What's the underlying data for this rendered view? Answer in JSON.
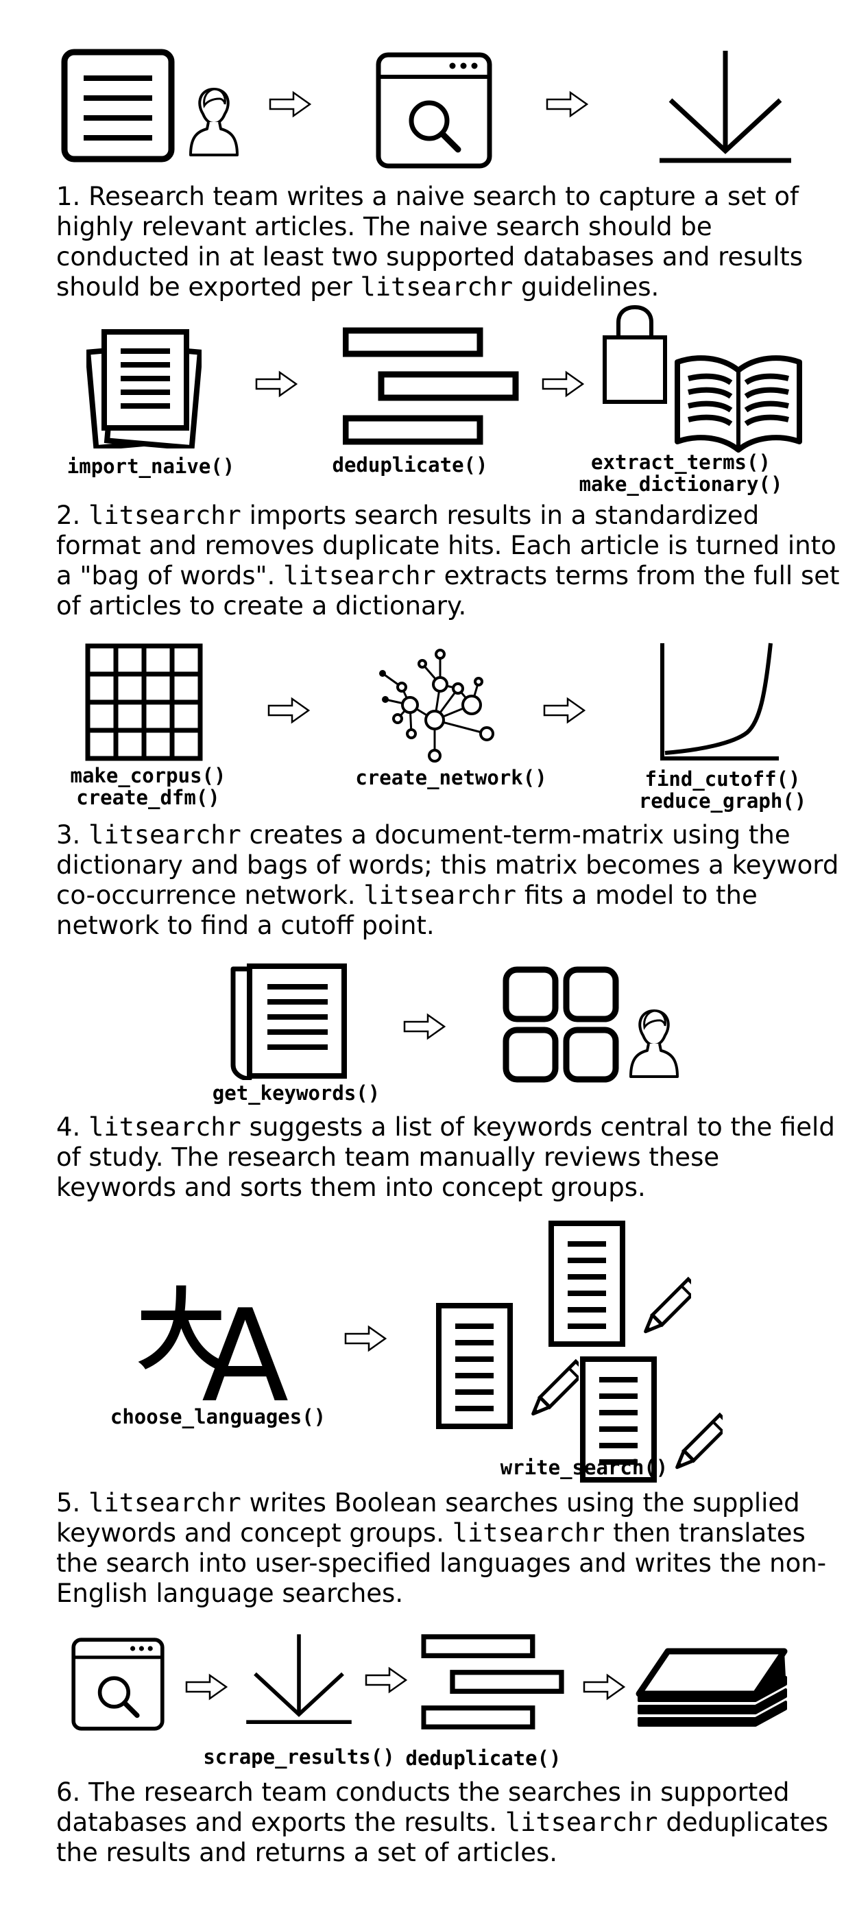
{
  "steps": [
    {
      "number": "1.",
      "description": [
        {
          "t": " Research team writes a naive search to capture a set of highly relevant articles. The naive search should be conducted in at least two supported databases and results should be exported per "
        },
        {
          "t": "litsearchr",
          "code": true
        },
        {
          "t": " guidelines."
        }
      ],
      "icons": [
        "document-icon",
        "person-icon",
        "browser-search-icon",
        "download-icon"
      ]
    },
    {
      "number": "2.",
      "labels": [
        "import_naive()",
        "deduplicate()",
        "extract_terms()",
        "make_dictionary()"
      ],
      "description": [
        {
          "t": " "
        },
        {
          "t": "litsearchr",
          "code": true
        },
        {
          "t": " imports search results in a standardized format and removes duplicate hits. Each article is turned into a \"bag of words\". "
        },
        {
          "t": "litsearchr",
          "code": true
        },
        {
          "t": " extracts terms from the full set of articles to create a dictionary."
        }
      ],
      "icons": [
        "documents-stack-icon",
        "bars-icon",
        "bag-icon",
        "book-icon"
      ]
    },
    {
      "number": "3.",
      "labels": [
        "make_corpus()",
        "create_dfm()",
        "create_network()",
        "find_cutoff()",
        "reduce_graph()"
      ],
      "description": [
        {
          "t": " "
        },
        {
          "t": "litsearchr",
          "code": true
        },
        {
          "t": " creates a document-term-matrix using the dictionary and bags of words; this matrix becomes a keyword co-occurrence network. "
        },
        {
          "t": "litsearchr",
          "code": true
        },
        {
          "t": " fits a model to the network to find a cutoff point."
        }
      ],
      "icons": [
        "grid-icon",
        "network-icon",
        "curve-chart-icon"
      ]
    },
    {
      "number": "4.",
      "labels": [
        "get_keywords()"
      ],
      "description": [
        {
          "t": " "
        },
        {
          "t": "litsearchr",
          "code": true
        },
        {
          "t": " suggests a list of keywords central to the field of study. The research team manually reviews these keywords and sorts them into concept groups."
        }
      ],
      "icons": [
        "document-scroll-icon",
        "four-squares-icon",
        "person-icon"
      ]
    },
    {
      "number": "5.",
      "labels": [
        "choose_languages()",
        "write_search()"
      ],
      "description": [
        {
          "t": " "
        },
        {
          "t": "litsearchr",
          "code": true
        },
        {
          "t": " writes Boolean searches using the supplied keywords and concept groups. "
        },
        {
          "t": "litsearchr",
          "code": true
        },
        {
          "t": " then translates the search into user-specified languages and writes the non-English language searches."
        }
      ],
      "icons": [
        "translate-icon",
        "document-pencil-icon"
      ],
      "translate_glyphs": [
        "大",
        "A"
      ]
    },
    {
      "number": "6.",
      "labels": [
        "scrape_results()",
        "deduplicate()"
      ],
      "description": [
        {
          "t": " The research team conducts the searches in supported databases and exports the results. "
        },
        {
          "t": "litsearchr",
          "code": true
        },
        {
          "t": " deduplicates the results and returns a set of articles."
        }
      ],
      "icons": [
        "browser-search-icon",
        "download-icon",
        "bars-icon",
        "paper-stack-icon"
      ]
    }
  ]
}
